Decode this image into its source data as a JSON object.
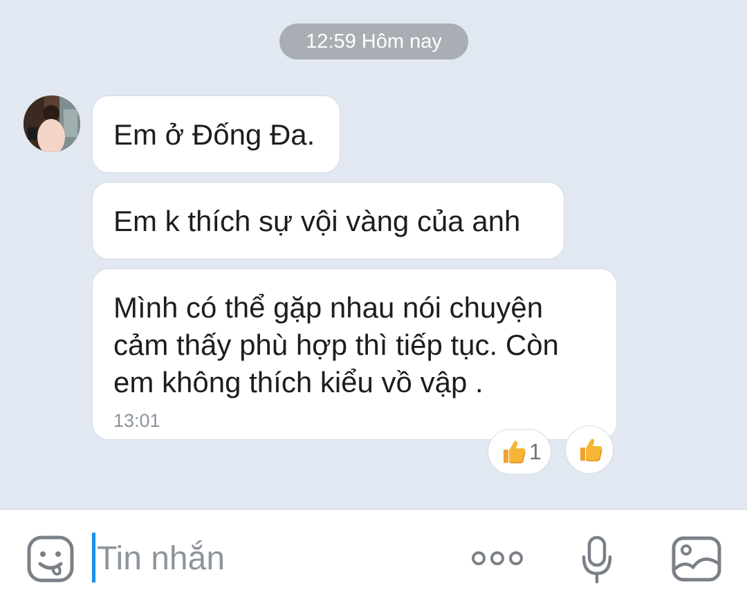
{
  "chat": {
    "time_divider": "12:59 Hôm nay",
    "messages": [
      {
        "text": "Em ở Đống Đa."
      },
      {
        "text": "Em k thích sự vội vàng của anh"
      },
      {
        "lines": [
          "Mình có thể gặp nhau nói chuyện",
          "cảm thấy phù hợp thì tiếp tục. Còn",
          "em không thích kiểu vồ vập ."
        ],
        "time": "13:01",
        "reaction_icon": "thumbs-up-icon",
        "reaction_count": "1"
      }
    ]
  },
  "composer": {
    "placeholder": "Tin nhắn",
    "icons": [
      "sticker-icon",
      "more-icon",
      "microphone-icon",
      "image-icon"
    ]
  },
  "colors": {
    "chat_background": "#e2e8f1",
    "time_pill": "#a9aeb4",
    "cursor": "#1a8ff0",
    "thumb": "#f5a623"
  }
}
